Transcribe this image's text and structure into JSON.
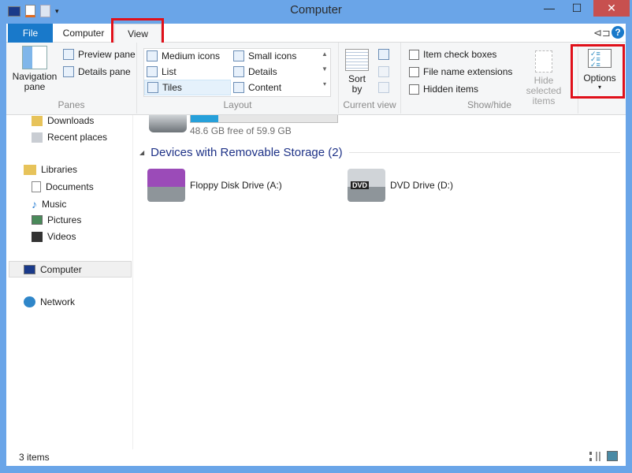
{
  "window": {
    "title": "Computer",
    "minimize": "—",
    "maximize": "☐",
    "close": "✕"
  },
  "tabs": [
    {
      "label": "File"
    },
    {
      "label": "Computer"
    },
    {
      "label": "View",
      "selected": true
    }
  ],
  "ribbon": {
    "panes": {
      "label": "Panes",
      "navigation_pane": "Navigation pane",
      "preview_pane": "Preview pane",
      "details_pane": "Details pane"
    },
    "layout": {
      "label": "Layout",
      "items": [
        "Medium icons",
        "Small icons",
        "List",
        "Details",
        "Tiles",
        "Content"
      ],
      "selected": "Tiles"
    },
    "current_view": {
      "label": "Current view",
      "sort_by": "Sort by"
    },
    "show_hide": {
      "label": "Show/hide",
      "item_check_boxes": "Item check boxes",
      "file_name_extensions": "File name extensions",
      "hidden_items": "Hidden items",
      "hide_selected_items": "Hide selected items"
    },
    "options": "Options"
  },
  "nav": {
    "downloads": "Downloads",
    "recent_places": "Recent places",
    "libraries": "Libraries",
    "documents": "Documents",
    "music": "Music",
    "pictures": "Pictures",
    "videos": "Videos",
    "computer": "Computer",
    "network": "Network"
  },
  "content": {
    "drive_free": "48.6 GB free of 59.9 GB",
    "drive_used_fraction": 0.19,
    "group_header": "Devices with Removable Storage (2)",
    "devices": [
      {
        "name": "Floppy Disk Drive (A:)"
      },
      {
        "name": "DVD Drive (D:)",
        "badge": "DVD"
      }
    ]
  },
  "status": {
    "items": "3 items"
  },
  "colors": {
    "accent": "#1979ca",
    "frame": "#6aa5e8",
    "highlight": "#e0101a"
  }
}
